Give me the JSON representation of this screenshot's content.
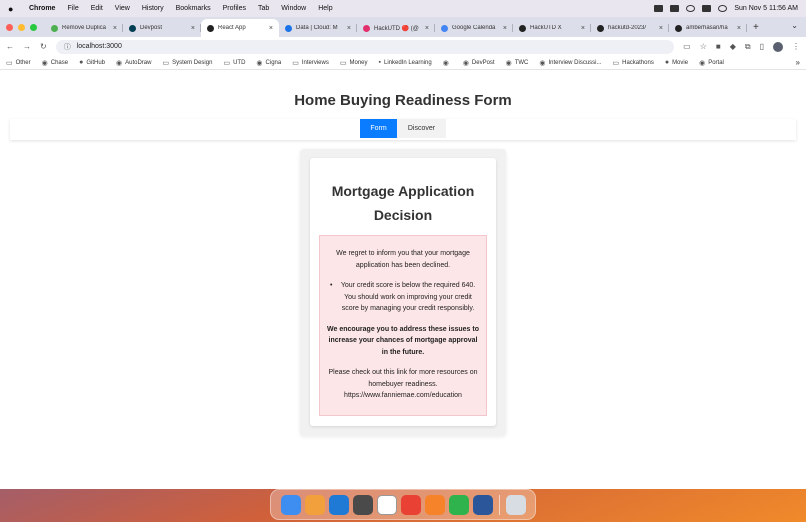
{
  "menubar": {
    "app_name": "Chrome",
    "items": [
      "File",
      "Edit",
      "View",
      "History",
      "Bookmarks",
      "Profiles",
      "Tab",
      "Window",
      "Help"
    ],
    "clock": "Sun Nov 5  11:56 AM"
  },
  "tabs": [
    {
      "label": "Remove Duplica",
      "icon": "tab-favicon",
      "color": "#4caf50"
    },
    {
      "label": "Devpost",
      "icon": "devpost-icon",
      "color": "#003e54"
    },
    {
      "label": "React App",
      "icon": "react-icon",
      "color": "#222222",
      "active": true
    },
    {
      "label": "Data | Cloud: M",
      "icon": "cloud-icon",
      "color": "#1a73e8"
    },
    {
      "label": "HackUTD 🔴 (@",
      "icon": "instagram-icon",
      "color": "#e1306c"
    },
    {
      "label": "Google Calenda",
      "icon": "calendar-icon",
      "color": "#4285f4"
    },
    {
      "label": "HackUTD X",
      "icon": "hackutd-icon",
      "color": "#222222"
    },
    {
      "label": "hackutd-2023/",
      "icon": "github-icon",
      "color": "#222222"
    },
    {
      "label": "amberhasan/ha",
      "icon": "github-icon",
      "color": "#222222"
    }
  ],
  "new_tab_glyph": "+",
  "address_bar": {
    "url": "localhost:3000"
  },
  "bookmarks": [
    {
      "label": "Other",
      "icon": "folder-icon"
    },
    {
      "label": "Chase",
      "icon": "chase-icon"
    },
    {
      "label": "GitHub",
      "icon": "github-icon"
    },
    {
      "label": "AutoDraw",
      "icon": "autodraw-icon"
    },
    {
      "label": "System Design",
      "icon": "folder-icon"
    },
    {
      "label": "UTD",
      "icon": "folder-icon"
    },
    {
      "label": "Cigna",
      "icon": "cigna-icon"
    },
    {
      "label": "Interviews",
      "icon": "folder-icon"
    },
    {
      "label": "Money",
      "icon": "folder-icon"
    },
    {
      "label": "LinkedIn Learning",
      "icon": "linkedin-icon"
    },
    {
      "label": "",
      "icon": "bookmark-icon"
    },
    {
      "label": "DevPost",
      "icon": "devpost-icon"
    },
    {
      "label": "TWC",
      "icon": "twc-icon"
    },
    {
      "label": "Interview Discussi...",
      "icon": "discuss-icon"
    },
    {
      "label": "Hackathons",
      "icon": "folder-icon"
    },
    {
      "label": "Movie",
      "icon": "github-icon"
    },
    {
      "label": "Portal",
      "icon": "portal-icon"
    }
  ],
  "page": {
    "title": "Home Buying Readiness Form",
    "nav": {
      "form": "Form",
      "discover": "Discover",
      "active": "form"
    },
    "decision": {
      "title": "Mortgage Application Decision",
      "intro": "We regret to inform you that your mortgage application has been declined.",
      "reasons": [
        "Your credit score is below the required 640. You should work on improving your credit score by managing your credit responsibly."
      ],
      "encouragement": "We encourage you to address these issues to increase your chances of mortgage approval in the future.",
      "resources": "Please check out this link for more resources on homebuyer readiness.",
      "link": "https://www.fanniemae.com/education"
    }
  },
  "colors": {
    "accent": "#0a7cff",
    "notice_bg": "#fde6e8",
    "notice_border": "#f3c6cb"
  },
  "dock": [
    {
      "name": "finder-icon",
      "color": "#3d8ef0"
    },
    {
      "name": "launchpad-icon",
      "color": "#f2a03c"
    },
    {
      "name": "vscode-icon",
      "color": "#1f7ad6"
    },
    {
      "name": "sublime-icon",
      "color": "#4a4a4a"
    },
    {
      "name": "notion-icon",
      "color": "#ffffff"
    },
    {
      "name": "chrome-icon",
      "color": "#e94235"
    },
    {
      "name": "pencil-icon",
      "color": "#f6822a"
    },
    {
      "name": "numbers-icon",
      "color": "#2fb34d"
    },
    {
      "name": "word-icon",
      "color": "#2b579a"
    },
    {
      "name": "trash-icon",
      "color": "#d8dde3"
    }
  ]
}
